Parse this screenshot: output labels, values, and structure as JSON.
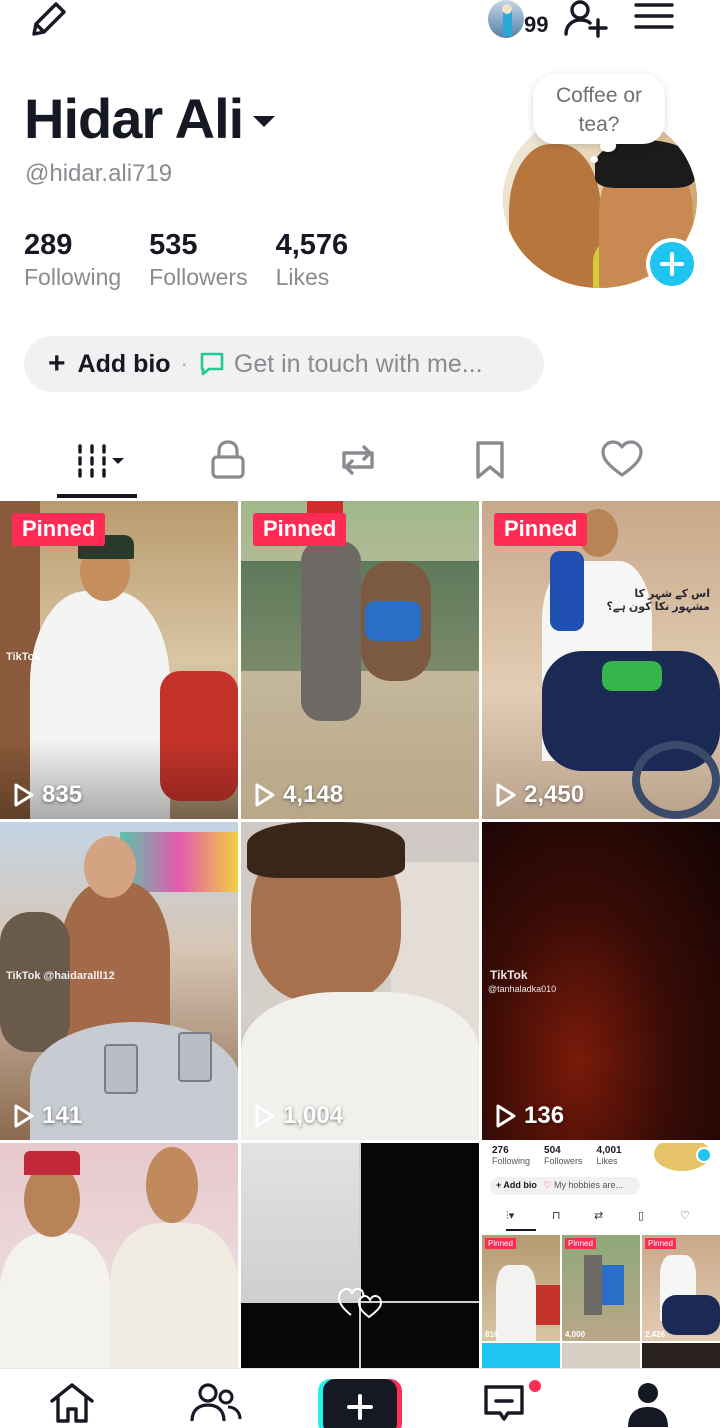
{
  "topbar": {
    "story_count": "99"
  },
  "profile": {
    "name": "Hidar Ali",
    "handle": "@hidar.ali719",
    "bubble_text": "Coffee or tea?",
    "stats": [
      {
        "value": "289",
        "label": "Following"
      },
      {
        "value": "535",
        "label": "Followers"
      },
      {
        "value": "4,576",
        "label": "Likes"
      }
    ]
  },
  "bio": {
    "add_label": "Add bio",
    "separator": "·",
    "touch_label": "Get in touch with me..."
  },
  "tabs": [
    "videos-icon",
    "lock-icon",
    "repost-icon",
    "bookmark-icon",
    "heart-icon"
  ],
  "grid": [
    {
      "pinned": "Pinned",
      "views": "835",
      "watermark": "TikTok"
    },
    {
      "pinned": "Pinned",
      "views": "4,148"
    },
    {
      "pinned": "Pinned",
      "views": "2,450",
      "overlay_text": "اس کے شہر کا مشہور نکا کون ہے؟"
    },
    {
      "views": "141",
      "watermark": "TikTok @haidaralll12"
    },
    {
      "views": "1,004"
    },
    {
      "views": "136",
      "watermark": "TikTok",
      "watermark_handle": "@tanhaladka010"
    },
    {},
    {},
    {
      "mini_profile": {
        "stats": [
          {
            "value": "276",
            "label": "Following"
          },
          {
            "value": "504",
            "label": "Followers"
          },
          {
            "value": "4,001",
            "label": "Likes"
          }
        ],
        "bio_add": "+ Add bio",
        "bio_touch": "My hobbies are...",
        "thumbs": [
          {
            "pinned": "Pinned",
            "views": "816"
          },
          {
            "pinned": "Pinned",
            "views": "4,000"
          },
          {
            "pinned": "Pinned",
            "views": "2,426"
          }
        ]
      }
    }
  ],
  "colors": {
    "accent": "#fe2c55",
    "cyan": "#25f4ee",
    "plus_blue": "#20c4f0",
    "text": "#161823",
    "muted": "#8a8b91"
  }
}
